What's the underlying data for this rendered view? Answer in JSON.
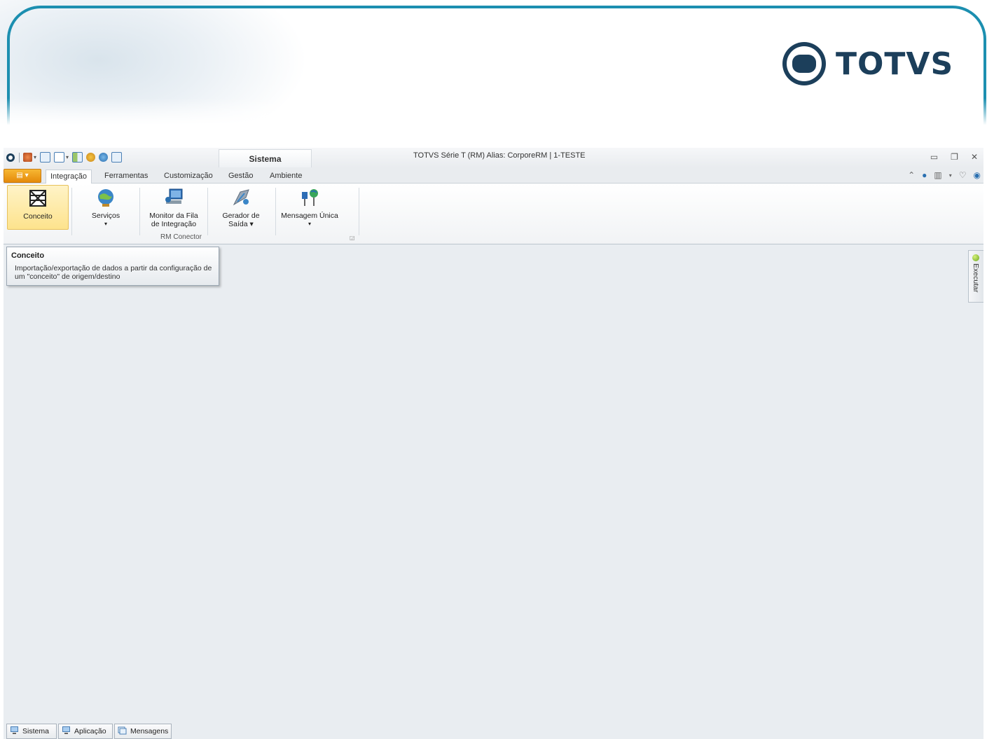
{
  "banner": {
    "logo_text": "TOTVS",
    "frame_color": "#1c8fb0",
    "logo_color": "#1c3f5b"
  },
  "titlebar": {
    "context_tab": "Sistema",
    "title": "TOTVS Série T  (RM) Alias: CorporeRM | 1-TESTE",
    "window_controls": [
      "minimize-icon",
      "restore-icon",
      "close-icon"
    ]
  },
  "tabs": [
    {
      "label": "Integração",
      "active": true
    },
    {
      "label": "Ferramentas",
      "active": false
    },
    {
      "label": "Customização",
      "active": false
    },
    {
      "label": "Gestão",
      "active": false
    },
    {
      "label": "Ambiente",
      "active": false
    }
  ],
  "ribbon": {
    "group_label": "RM Conector",
    "buttons": [
      {
        "line1": "Conceito",
        "line2": "",
        "icon": "concept-grid-icon"
      },
      {
        "line1": "Serviços",
        "line2": "▾",
        "icon": "services-globe-icon"
      },
      {
        "line1": "Monitor da Fila",
        "line2": "de Integração",
        "icon": "queue-monitor-icon"
      },
      {
        "line1": "Gerador de",
        "line2": "Saída ▾",
        "icon": "output-generator-icon"
      },
      {
        "line1": "Mensagem Única",
        "line2": "▾",
        "icon": "single-message-icon"
      }
    ]
  },
  "tooltip": {
    "title": "Conceito",
    "body": "Importação/exportação de dados a partir da configuração de um \"conceito\" de origem/destino"
  },
  "side_panel": {
    "label": "Executar"
  },
  "statusbar": {
    "buttons": [
      {
        "label": "Sistema",
        "icon": "computer-icon"
      },
      {
        "label": "Aplicação",
        "icon": "computer-icon"
      },
      {
        "label": "Mensagens",
        "icon": "messages-icon"
      }
    ]
  },
  "colors": {
    "accent": "#e58a0a",
    "selected_button": "#fde38d",
    "workspace": "#e9edf1"
  }
}
